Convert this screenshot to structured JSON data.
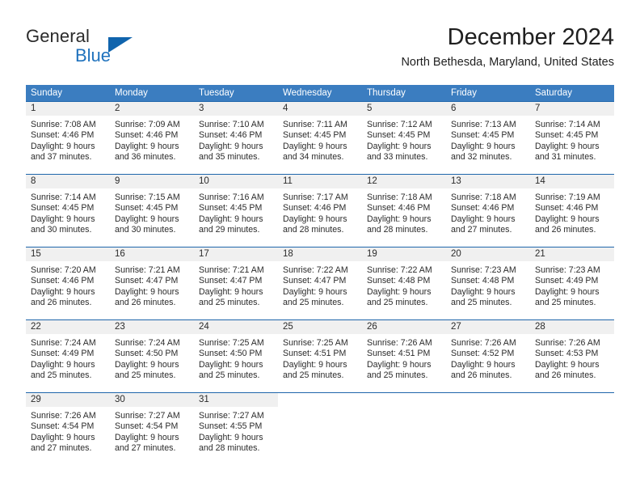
{
  "brand": {
    "name_part1": "General",
    "name_part2": "Blue",
    "logo_icon": "triangle-icon"
  },
  "header": {
    "title": "December 2024",
    "subtitle": "North Bethesda, Maryland, United States"
  },
  "weekdays": [
    "Sunday",
    "Monday",
    "Tuesday",
    "Wednesday",
    "Thursday",
    "Friday",
    "Saturday"
  ],
  "colors": {
    "header_blue": "#3b7dc0",
    "row_divider_blue": "#1f66ab",
    "day_number_band": "#f0f0f0",
    "brand_blue": "#1f72bd",
    "text": "#2b2b2b"
  },
  "weeks": [
    [
      {
        "day": "1",
        "sunrise": "Sunrise: 7:08 AM",
        "sunset": "Sunset: 4:46 PM",
        "daylight_line1": "Daylight: 9 hours",
        "daylight_line2": "and 37 minutes."
      },
      {
        "day": "2",
        "sunrise": "Sunrise: 7:09 AM",
        "sunset": "Sunset: 4:46 PM",
        "daylight_line1": "Daylight: 9 hours",
        "daylight_line2": "and 36 minutes."
      },
      {
        "day": "3",
        "sunrise": "Sunrise: 7:10 AM",
        "sunset": "Sunset: 4:46 PM",
        "daylight_line1": "Daylight: 9 hours",
        "daylight_line2": "and 35 minutes."
      },
      {
        "day": "4",
        "sunrise": "Sunrise: 7:11 AM",
        "sunset": "Sunset: 4:45 PM",
        "daylight_line1": "Daylight: 9 hours",
        "daylight_line2": "and 34 minutes."
      },
      {
        "day": "5",
        "sunrise": "Sunrise: 7:12 AM",
        "sunset": "Sunset: 4:45 PM",
        "daylight_line1": "Daylight: 9 hours",
        "daylight_line2": "and 33 minutes."
      },
      {
        "day": "6",
        "sunrise": "Sunrise: 7:13 AM",
        "sunset": "Sunset: 4:45 PM",
        "daylight_line1": "Daylight: 9 hours",
        "daylight_line2": "and 32 minutes."
      },
      {
        "day": "7",
        "sunrise": "Sunrise: 7:14 AM",
        "sunset": "Sunset: 4:45 PM",
        "daylight_line1": "Daylight: 9 hours",
        "daylight_line2": "and 31 minutes."
      }
    ],
    [
      {
        "day": "8",
        "sunrise": "Sunrise: 7:14 AM",
        "sunset": "Sunset: 4:45 PM",
        "daylight_line1": "Daylight: 9 hours",
        "daylight_line2": "and 30 minutes."
      },
      {
        "day": "9",
        "sunrise": "Sunrise: 7:15 AM",
        "sunset": "Sunset: 4:45 PM",
        "daylight_line1": "Daylight: 9 hours",
        "daylight_line2": "and 30 minutes."
      },
      {
        "day": "10",
        "sunrise": "Sunrise: 7:16 AM",
        "sunset": "Sunset: 4:45 PM",
        "daylight_line1": "Daylight: 9 hours",
        "daylight_line2": "and 29 minutes."
      },
      {
        "day": "11",
        "sunrise": "Sunrise: 7:17 AM",
        "sunset": "Sunset: 4:46 PM",
        "daylight_line1": "Daylight: 9 hours",
        "daylight_line2": "and 28 minutes."
      },
      {
        "day": "12",
        "sunrise": "Sunrise: 7:18 AM",
        "sunset": "Sunset: 4:46 PM",
        "daylight_line1": "Daylight: 9 hours",
        "daylight_line2": "and 28 minutes."
      },
      {
        "day": "13",
        "sunrise": "Sunrise: 7:18 AM",
        "sunset": "Sunset: 4:46 PM",
        "daylight_line1": "Daylight: 9 hours",
        "daylight_line2": "and 27 minutes."
      },
      {
        "day": "14",
        "sunrise": "Sunrise: 7:19 AM",
        "sunset": "Sunset: 4:46 PM",
        "daylight_line1": "Daylight: 9 hours",
        "daylight_line2": "and 26 minutes."
      }
    ],
    [
      {
        "day": "15",
        "sunrise": "Sunrise: 7:20 AM",
        "sunset": "Sunset: 4:46 PM",
        "daylight_line1": "Daylight: 9 hours",
        "daylight_line2": "and 26 minutes."
      },
      {
        "day": "16",
        "sunrise": "Sunrise: 7:21 AM",
        "sunset": "Sunset: 4:47 PM",
        "daylight_line1": "Daylight: 9 hours",
        "daylight_line2": "and 26 minutes."
      },
      {
        "day": "17",
        "sunrise": "Sunrise: 7:21 AM",
        "sunset": "Sunset: 4:47 PM",
        "daylight_line1": "Daylight: 9 hours",
        "daylight_line2": "and 25 minutes."
      },
      {
        "day": "18",
        "sunrise": "Sunrise: 7:22 AM",
        "sunset": "Sunset: 4:47 PM",
        "daylight_line1": "Daylight: 9 hours",
        "daylight_line2": "and 25 minutes."
      },
      {
        "day": "19",
        "sunrise": "Sunrise: 7:22 AM",
        "sunset": "Sunset: 4:48 PM",
        "daylight_line1": "Daylight: 9 hours",
        "daylight_line2": "and 25 minutes."
      },
      {
        "day": "20",
        "sunrise": "Sunrise: 7:23 AM",
        "sunset": "Sunset: 4:48 PM",
        "daylight_line1": "Daylight: 9 hours",
        "daylight_line2": "and 25 minutes."
      },
      {
        "day": "21",
        "sunrise": "Sunrise: 7:23 AM",
        "sunset": "Sunset: 4:49 PM",
        "daylight_line1": "Daylight: 9 hours",
        "daylight_line2": "and 25 minutes."
      }
    ],
    [
      {
        "day": "22",
        "sunrise": "Sunrise: 7:24 AM",
        "sunset": "Sunset: 4:49 PM",
        "daylight_line1": "Daylight: 9 hours",
        "daylight_line2": "and 25 minutes."
      },
      {
        "day": "23",
        "sunrise": "Sunrise: 7:24 AM",
        "sunset": "Sunset: 4:50 PM",
        "daylight_line1": "Daylight: 9 hours",
        "daylight_line2": "and 25 minutes."
      },
      {
        "day": "24",
        "sunrise": "Sunrise: 7:25 AM",
        "sunset": "Sunset: 4:50 PM",
        "daylight_line1": "Daylight: 9 hours",
        "daylight_line2": "and 25 minutes."
      },
      {
        "day": "25",
        "sunrise": "Sunrise: 7:25 AM",
        "sunset": "Sunset: 4:51 PM",
        "daylight_line1": "Daylight: 9 hours",
        "daylight_line2": "and 25 minutes."
      },
      {
        "day": "26",
        "sunrise": "Sunrise: 7:26 AM",
        "sunset": "Sunset: 4:51 PM",
        "daylight_line1": "Daylight: 9 hours",
        "daylight_line2": "and 25 minutes."
      },
      {
        "day": "27",
        "sunrise": "Sunrise: 7:26 AM",
        "sunset": "Sunset: 4:52 PM",
        "daylight_line1": "Daylight: 9 hours",
        "daylight_line2": "and 26 minutes."
      },
      {
        "day": "28",
        "sunrise": "Sunrise: 7:26 AM",
        "sunset": "Sunset: 4:53 PM",
        "daylight_line1": "Daylight: 9 hours",
        "daylight_line2": "and 26 minutes."
      }
    ],
    [
      {
        "day": "29",
        "sunrise": "Sunrise: 7:26 AM",
        "sunset": "Sunset: 4:54 PM",
        "daylight_line1": "Daylight: 9 hours",
        "daylight_line2": "and 27 minutes."
      },
      {
        "day": "30",
        "sunrise": "Sunrise: 7:27 AM",
        "sunset": "Sunset: 4:54 PM",
        "daylight_line1": "Daylight: 9 hours",
        "daylight_line2": "and 27 minutes."
      },
      {
        "day": "31",
        "sunrise": "Sunrise: 7:27 AM",
        "sunset": "Sunset: 4:55 PM",
        "daylight_line1": "Daylight: 9 hours",
        "daylight_line2": "and 28 minutes."
      },
      {
        "day": "",
        "sunrise": "",
        "sunset": "",
        "daylight_line1": "",
        "daylight_line2": ""
      },
      {
        "day": "",
        "sunrise": "",
        "sunset": "",
        "daylight_line1": "",
        "daylight_line2": ""
      },
      {
        "day": "",
        "sunrise": "",
        "sunset": "",
        "daylight_line1": "",
        "daylight_line2": ""
      },
      {
        "day": "",
        "sunrise": "",
        "sunset": "",
        "daylight_line1": "",
        "daylight_line2": ""
      }
    ]
  ]
}
